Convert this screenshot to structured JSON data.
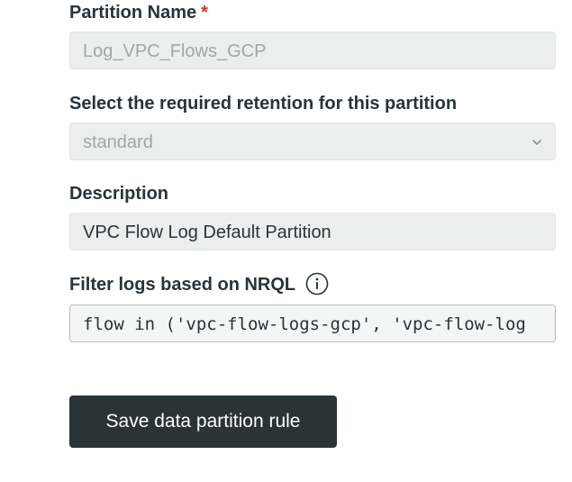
{
  "form": {
    "partition_name": {
      "label": "Partition Name",
      "required_marker": "*",
      "value": "Log_VPC_Flows_GCP"
    },
    "retention": {
      "label": "Select the required retention for this partition",
      "selected": "standard"
    },
    "description": {
      "label": "Description",
      "value": "VPC Flow Log Default Partition"
    },
    "filter": {
      "label": "Filter logs based on NRQL",
      "value": "flow in ('vpc-flow-logs-gcp', 'vpc-flow-log"
    },
    "save_label": "Save data partition rule"
  },
  "colors": {
    "text": "#293338",
    "required": "#df2d24",
    "field_bg": "#eceeee",
    "button_bg": "#293338"
  },
  "icons": {
    "chevron": "chevron-down-icon",
    "info": "info-icon"
  }
}
